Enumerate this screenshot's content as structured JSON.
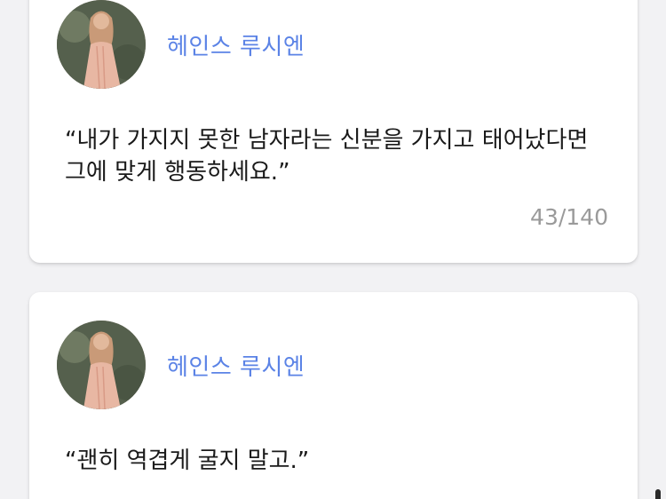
{
  "cards": [
    {
      "author": "헤인스 루시엔",
      "quote": "“내가 가지지 못한 남자라는 신분을 가지고 태어났다면\n그에 맞게 행동하세요.”",
      "counter": "43/140",
      "avatar_icon": "portrait-avatar"
    },
    {
      "author": "헤인스 루시엔",
      "quote": "“괜히 역겹게 굴지 말고.”",
      "avatar_icon": "portrait-avatar"
    }
  ],
  "colors": {
    "background": "#f2f2f4",
    "card": "#ffffff",
    "author_name": "#5b83e6",
    "quote_text": "#1a1a1a",
    "counter_text": "#9a9a9a"
  }
}
